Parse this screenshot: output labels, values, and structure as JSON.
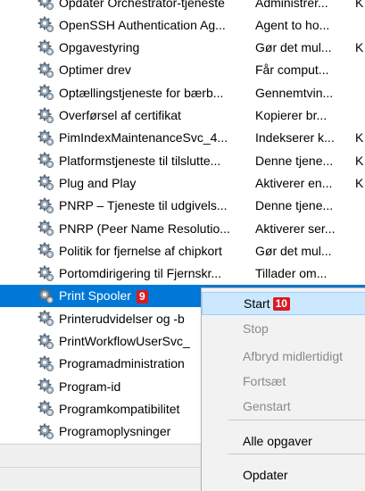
{
  "services": [
    {
      "name": "Opdater Orchestrator-tjeneste",
      "desc": "Administrer...",
      "extra": "K"
    },
    {
      "name": "OpenSSH Authentication Ag...",
      "desc": "Agent to ho...",
      "extra": ""
    },
    {
      "name": "Opgavestyring",
      "desc": "Gør det mul...",
      "extra": "K"
    },
    {
      "name": "Optimer drev",
      "desc": "Får comput...",
      "extra": ""
    },
    {
      "name": "Optællingstjeneste for bærb...",
      "desc": "Gennemtvin...",
      "extra": ""
    },
    {
      "name": "Overførsel af certifikat",
      "desc": "Kopierer br...",
      "extra": ""
    },
    {
      "name": "PimIndexMaintenanceSvc_4...",
      "desc": "Indekserer k...",
      "extra": "K"
    },
    {
      "name": "Platformstjeneste til tilslutte...",
      "desc": "Denne tjene...",
      "extra": "K"
    },
    {
      "name": "Plug and Play",
      "desc": "Aktiverer en...",
      "extra": "K"
    },
    {
      "name": "PNRP – Tjeneste til udgivels...",
      "desc": "Denne tjene...",
      "extra": ""
    },
    {
      "name": "PNRP (Peer Name Resolutio...",
      "desc": "Aktiverer ser...",
      "extra": ""
    },
    {
      "name": "Politik for fjernelse af chipkort",
      "desc": "Gør det mul...",
      "extra": ""
    },
    {
      "name": "Portomdirigering til Fjernskr...",
      "desc": "Tillader om...",
      "extra": ""
    },
    {
      "name": "Print Spooler",
      "desc": "",
      "extra": "",
      "badge": "9",
      "selected": true
    },
    {
      "name": "Printerudvidelser og -b",
      "desc": "",
      "extra": ""
    },
    {
      "name": "PrintWorkflowUserSvc_",
      "desc": "",
      "extra": ""
    },
    {
      "name": "Programadministration",
      "desc": "",
      "extra": ""
    },
    {
      "name": "Program-id",
      "desc": "",
      "extra": ""
    },
    {
      "name": "Programkompatibilitet",
      "desc": "",
      "extra": ""
    },
    {
      "name": "Programoplysninger",
      "desc": "",
      "extra": ""
    }
  ],
  "context_menu": {
    "items": [
      {
        "label": "Start",
        "badge": "10",
        "enabled": true,
        "highlighted": true
      },
      {
        "label": "Stop",
        "enabled": false
      },
      {
        "label": "Afbryd midlertidigt",
        "enabled": false
      },
      {
        "label": "Fortsæt",
        "enabled": false
      },
      {
        "label": "Genstart",
        "enabled": false
      },
      {
        "label": "Alle opgaver",
        "enabled": true
      },
      {
        "label": "Opdater",
        "enabled": true
      }
    ]
  },
  "icon": "gear-icon",
  "colors": {
    "selection": "#0078d7",
    "menu_highlight": "#cce8ff",
    "badge": "#d81b22"
  }
}
